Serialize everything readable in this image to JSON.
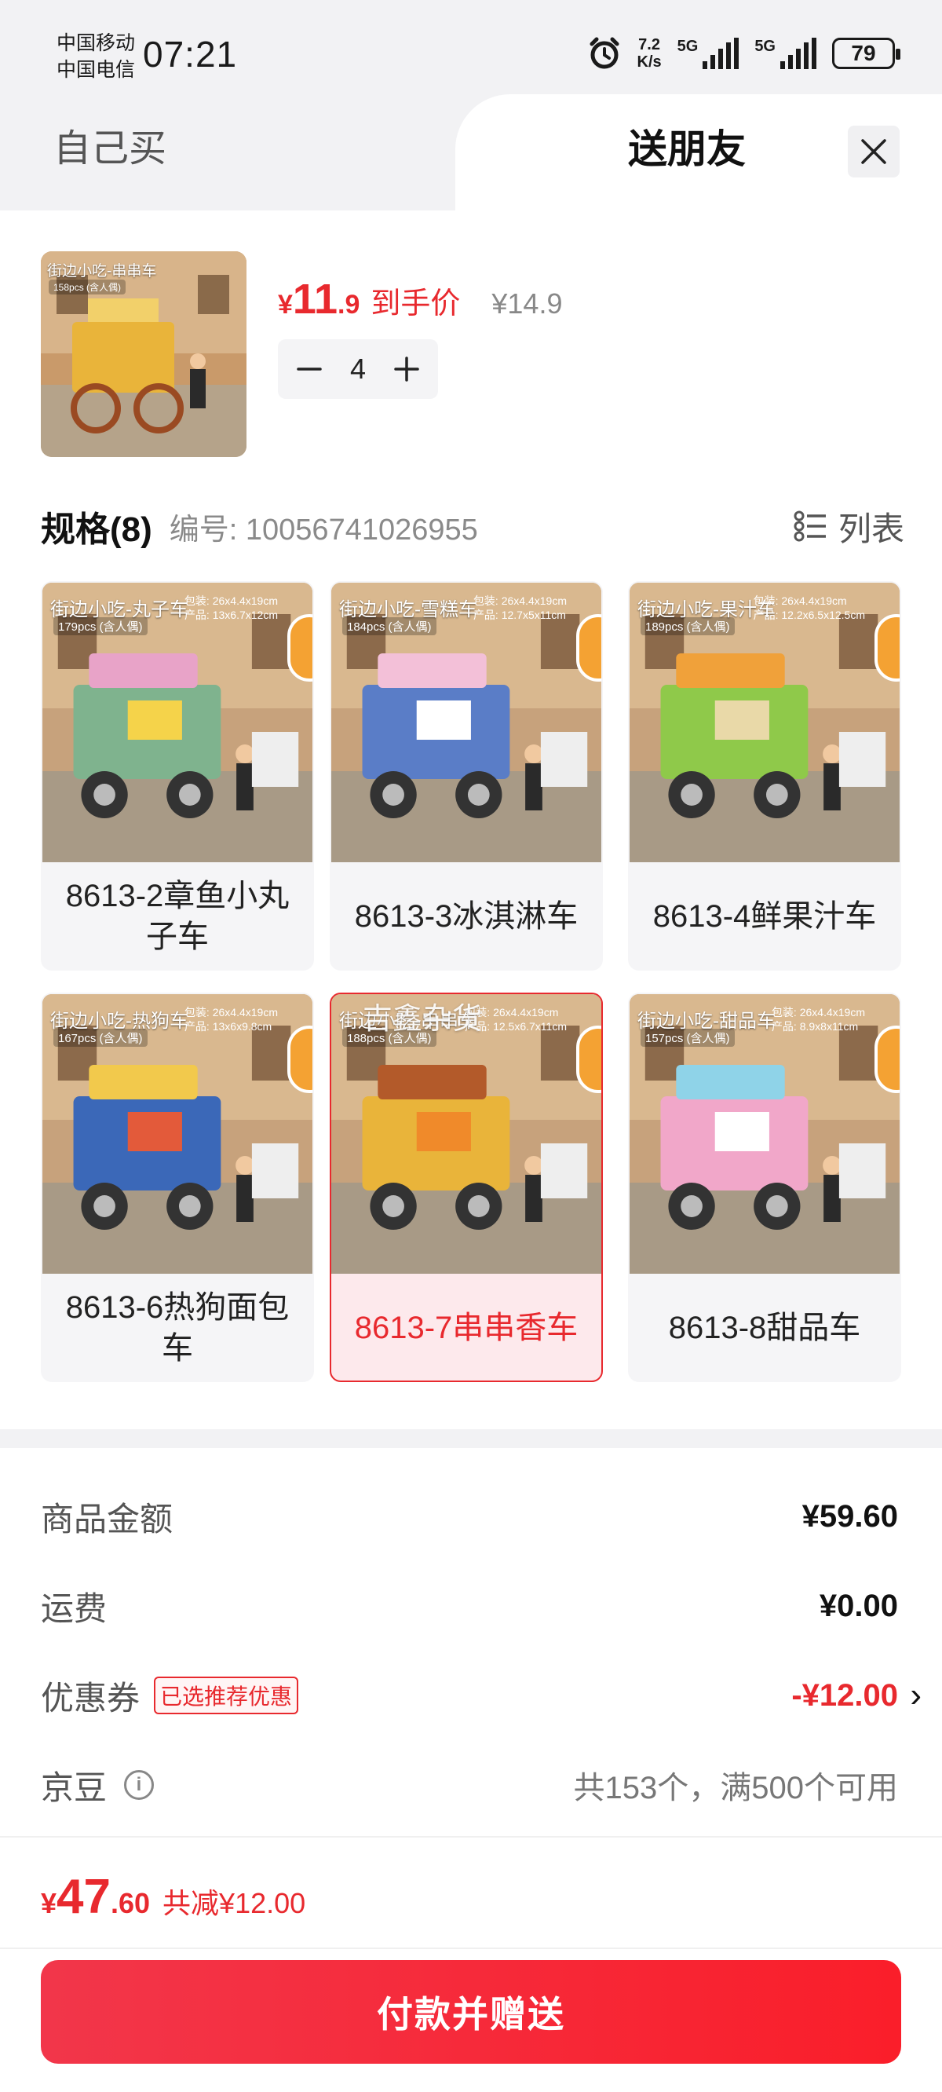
{
  "status_bar": {
    "carrier1": "中国移动",
    "carrier2": "中国电信",
    "time": "07:21",
    "net_speed_value": "7.2",
    "net_speed_unit": "K/s",
    "sim1": "5G",
    "sim2": "5G",
    "battery": "79"
  },
  "tabs": {
    "self": "自己买",
    "gift": "送朋友"
  },
  "product": {
    "thumb_caption": "街边小吃-串串车",
    "thumb_sub": "158pcs (含人偶)",
    "price_yen": "¥",
    "price_int": "11",
    "price_dec": ".9",
    "price_tag": "到手价",
    "price_original": "¥14.9",
    "quantity": "4"
  },
  "spec": {
    "title": "规格(8)",
    "code": "编号: 10056741026955",
    "list_toggle": "列表"
  },
  "options": [
    {
      "caption": "街边小吃-丸子车",
      "sub": "179pcs (含人偶)",
      "dims1": "包装: 26x4.4x19cm",
      "dims2": "产品: 13x6.7x12cm",
      "name": "8613-2章鱼小丸子车",
      "colors": [
        "#7fb38e",
        "#e8a3c8",
        "#f5d34a"
      ]
    },
    {
      "caption": "街边小吃-雪糕车",
      "sub": "184pcs (含人偶)",
      "dims1": "包装: 26x4.4x19cm",
      "dims2": "产品: 12.7x5x11cm",
      "name": "8613-3冰淇淋车",
      "colors": [
        "#5a7dc7",
        "#f3c0d8",
        "#ffffff"
      ]
    },
    {
      "caption": "街边小吃-果汁车",
      "sub": "189pcs (含人偶)",
      "dims1": "包装: 26x4.4x19cm",
      "dims2": "产品: 12.2x6.5x12.5cm",
      "name": "8613-4鲜果汁车",
      "colors": [
        "#8fc94a",
        "#f0a13a",
        "#e9d9a8"
      ]
    },
    {
      "caption": "街边小吃-热狗车",
      "sub": "167pcs (含人偶)",
      "dims1": "包装: 26x4.4x19cm",
      "dims2": "产品: 13x6x9.8cm",
      "name": "8613-6热狗面包车",
      "colors": [
        "#3b68b8",
        "#f2c94c",
        "#e35a3a"
      ]
    },
    {
      "caption": "街边小吃-串串车",
      "sub": "188pcs (含人偶)",
      "dims1": "包装: 26x4.4x19cm",
      "dims2": "产品: 12.5x6.7x11cm",
      "name": "8613-7串串香车",
      "colors": [
        "#e9b43a",
        "#b35a2a",
        "#f08a2a"
      ],
      "watermark": "吉鑫杂货"
    },
    {
      "caption": "街边小吃-甜品车",
      "sub": "157pcs (含人偶)",
      "dims1": "包装: 26x4.4x19cm",
      "dims2": "产品: 8.9x8x11cm",
      "name": "8613-8甜品车",
      "colors": [
        "#f1a7c9",
        "#8fd3e8",
        "#ffffff"
      ]
    }
  ],
  "summary": {
    "goods_label": "商品金额",
    "goods_value": "¥59.60",
    "shipping_label": "运费",
    "shipping_value": "¥0.00",
    "coupon_label": "优惠券",
    "coupon_tag": "已选推荐优惠",
    "coupon_value": "-¥12.00",
    "coupon_chevron": "›",
    "jd_label": "京豆",
    "jd_info": "i",
    "jd_value": "共153个，满500个可用"
  },
  "footer": {
    "total_yen": "¥",
    "total_int": "47",
    "total_dec": ".60",
    "discount": "共减¥12.00",
    "pay_button": "付款并赠送"
  },
  "colors": {
    "accent": "#e8292e",
    "selected_bg": "#fde9ec"
  }
}
